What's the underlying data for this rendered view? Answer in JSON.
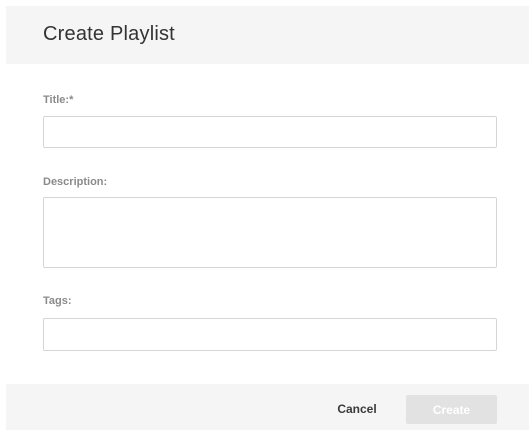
{
  "dialog": {
    "title": "Create Playlist"
  },
  "form": {
    "title_label": "Title:*",
    "title_value": "",
    "description_label": "Description:",
    "description_value": "",
    "tags_label": "Tags:",
    "tags_value": ""
  },
  "footer": {
    "cancel_label": "Cancel",
    "create_label": "Create",
    "create_enabled": false
  },
  "colors": {
    "header_background": "#f5f5f5",
    "footer_background": "#f5f5f5",
    "label_text": "#8a8a8a",
    "input_border": "#d5d5d5",
    "create_disabled_background": "#e2e2e2"
  }
}
